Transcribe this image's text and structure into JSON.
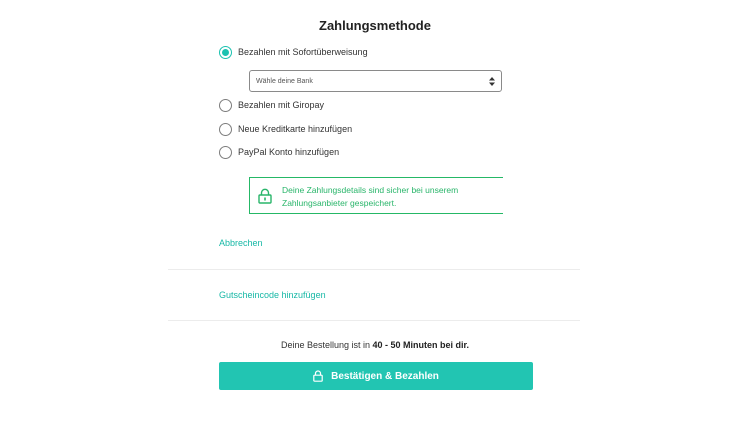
{
  "payment": {
    "title": "Zahlungsmethode",
    "options": [
      {
        "label": "Bezahlen mit Sofortüberweisung",
        "selected": true
      },
      {
        "label": "Bezahlen mit Giropay",
        "selected": false
      },
      {
        "label": "Neue Kreditkarte hinzufügen",
        "selected": false
      },
      {
        "label": "PayPal Konto hinzufügen",
        "selected": false
      }
    ],
    "bank_select": {
      "value": "Wähle deine Bank"
    },
    "secure_note": {
      "line1": "Deine Zahlungsdetails sind sicher bei unserem",
      "line2": "Zahlungsanbieter gespeichert.",
      "icon": "lock-icon",
      "color": "#29b56a"
    },
    "cancel_link": "Abbrechen"
  },
  "voucher": {
    "link": "Gutscheincode hinzufügen"
  },
  "delivery": {
    "prefix": "Deine Bestellung ist in ",
    "time": "40 - 50 Minuten bei dir."
  },
  "confirm_button": {
    "label": "Bestätigen & Bezahlen",
    "icon": "lock-icon",
    "color": "#22c5b2"
  },
  "colors": {
    "accent": "#1bc2b0",
    "secure_green": "#29b56a",
    "link": "#17b8a6"
  }
}
